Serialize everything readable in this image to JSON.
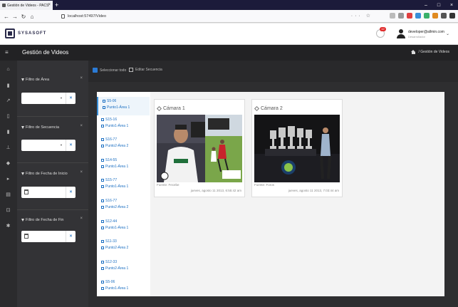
{
  "browser": {
    "tab_title": "Gestión de Videos - PACS",
    "url": "localhost:57497/Video",
    "url_icons": "··· ☆"
  },
  "app": {
    "logo_text": "SYSASOFT",
    "notification_count": "12",
    "user_email": "developer@allmin.com",
    "user_role": "Desarrollador"
  },
  "titlebar": {
    "title": "Gestión de Videos",
    "breadcrumb": "/ Gestión de Videos"
  },
  "filters": [
    {
      "label": "Filtro de Área",
      "type": "select"
    },
    {
      "label": "Filtro de Secuencia",
      "type": "select"
    },
    {
      "label": "Filtro de Fecha de Inicio",
      "type": "date"
    },
    {
      "label": "Filtro de Fecha de Fin",
      "type": "date"
    }
  ],
  "toolbar": {
    "select_all": "Seleccionar todo",
    "edit_sequence": "Editar Secuencia"
  },
  "sequences": [
    {
      "code": "S5-06",
      "area": "Punto1-Área 1"
    },
    {
      "code": "S15-16",
      "area": "Punto1-Área 1"
    },
    {
      "code": "S16-77",
      "area": "Punto2-Área 2"
    },
    {
      "code": "S14-55",
      "area": "Punto1-Área 1"
    },
    {
      "code": "S15-77",
      "area": "Punto1-Área 1"
    },
    {
      "code": "S16-77",
      "area": "Punto2-Área 2"
    },
    {
      "code": "S12-44",
      "area": "Punto1-Área 1"
    },
    {
      "code": "S11-33",
      "area": "Punto2-Área 2"
    },
    {
      "code": "S12-33",
      "area": "Punto2-Área 1"
    },
    {
      "code": "S5-06",
      "area": "Punto1-Área 1"
    }
  ],
  "cameras": [
    {
      "title": "Cámara 1",
      "source": "Fuente: Fecebe",
      "date": "jueves, agosto 11 2013, 6:55:42 am"
    },
    {
      "title": "Cámara 2",
      "source": "Fuente: Foros",
      "date": "jueves, agosto 11 2013, 7:03:44 am"
    }
  ],
  "colors": {
    "accent": "#2b7bd6",
    "link": "#1b6fc2",
    "dark_bg": "#2e2e30",
    "title_bg": "#222224"
  }
}
